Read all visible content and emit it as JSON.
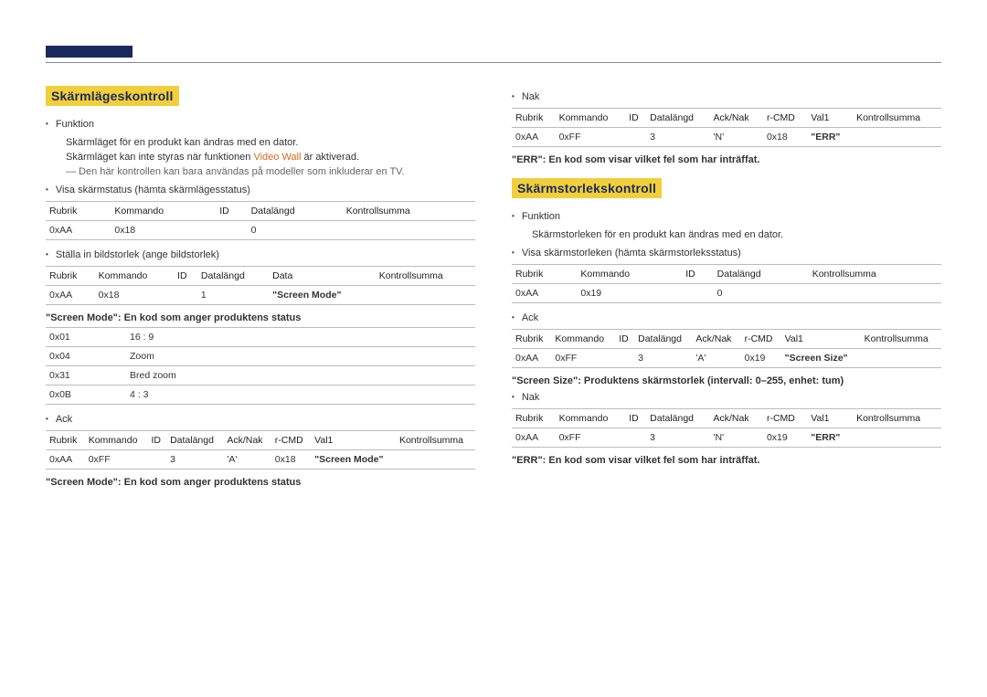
{
  "left": {
    "title": "Skärmlägeskontroll",
    "func_lbl": "Funktion",
    "func_l1": "Skärmläget för en produkt kan ändras med en dator.",
    "func_l2_a": "Skärmläget kan inte styras när funktionen",
    "func_l2_em": " Video Wall",
    "func_l2_b": " är aktiverad.",
    "note": "― Den här kontrollen kan bara användas på modeller som inkluderar en TV.",
    "view_lbl": "Visa skärmstatus (hämta skärmlägesstatus)",
    "tbl1_head": [
      "Rubrik",
      "Kommando",
      "ID",
      "Datalängd",
      "Kontrollsumma"
    ],
    "tbl1_row": [
      "0xAA",
      "0x18",
      "",
      "0",
      ""
    ],
    "set_lbl": "Ställa in bildstorlek (ange bildstorlek)",
    "tbl2_head": [
      "Rubrik",
      "Kommando",
      "ID",
      "Datalängd",
      "Data",
      "Kontrollsumma"
    ],
    "tbl2_row": [
      "0xAA",
      "0x18",
      "",
      "1",
      "\"Screen Mode\"",
      ""
    ],
    "screen_mode_lbl": "\"Screen Mode\": En kod som anger produktens status",
    "modes": [
      [
        "0x01",
        "16 : 9"
      ],
      [
        "0x04",
        "Zoom"
      ],
      [
        "0x31",
        "Bred zoom"
      ],
      [
        "0x0B",
        "4 : 3"
      ]
    ],
    "ack_lbl": "Ack",
    "tbl3_head": [
      "Rubrik",
      "Kommando",
      "ID",
      "Datalängd",
      "Ack/Nak",
      "r-CMD",
      "Val1",
      "Kontrollsumma"
    ],
    "tbl3_row": [
      "0xAA",
      "0xFF",
      "",
      "3",
      "'A'",
      "0x18",
      "\"Screen Mode\"",
      ""
    ],
    "screen_mode_lbl2": "\"Screen Mode\": En kod som anger produktens status"
  },
  "right": {
    "nak_lbl": "Nak",
    "tbl_nak_head": [
      "Rubrik",
      "Kommando",
      "ID",
      "Datalängd",
      "Ack/Nak",
      "r-CMD",
      "Val1",
      "Kontrollsumma"
    ],
    "tbl_nak_row": [
      "0xAA",
      "0xFF",
      "",
      "3",
      "'N'",
      "0x18",
      "\"ERR\"",
      ""
    ],
    "err_lbl": "\"ERR\": En kod som visar vilket fel som har inträffat.",
    "title": "Skärmstorlekskontroll",
    "func_lbl": "Funktion",
    "func_l1": "Skärmstorleken för en produkt kan ändras med en dator.",
    "view_lbl": "Visa skärmstorleken (hämta skärmstorleksstatus)",
    "tbl1_head": [
      "Rubrik",
      "Kommando",
      "ID",
      "Datalängd",
      "Kontrollsumma"
    ],
    "tbl1_row": [
      "0xAA",
      "0x19",
      "",
      "0",
      ""
    ],
    "ack_lbl": "Ack",
    "tbl2_head": [
      "Rubrik",
      "Kommando",
      "ID",
      "Datalängd",
      "Ack/Nak",
      "r-CMD",
      "Val1",
      "Kontrollsumma"
    ],
    "tbl2_row": [
      "0xAA",
      "0xFF",
      "",
      "3",
      "'A'",
      "0x19",
      "\"Screen Size\"",
      ""
    ],
    "size_lbl": "\"Screen Size\": Produktens skärmstorlek (intervall: 0–255, enhet: tum)",
    "nak2_lbl": "Nak",
    "tbl3_head": [
      "Rubrik",
      "Kommando",
      "ID",
      "Datalängd",
      "Ack/Nak",
      "r-CMD",
      "Val1",
      "Kontrollsumma"
    ],
    "tbl3_row": [
      "0xAA",
      "0xFF",
      "",
      "3",
      "'N'",
      "0x19",
      "\"ERR\"",
      ""
    ],
    "err2_lbl": "\"ERR\": En kod som visar vilket fel som har inträffat."
  }
}
